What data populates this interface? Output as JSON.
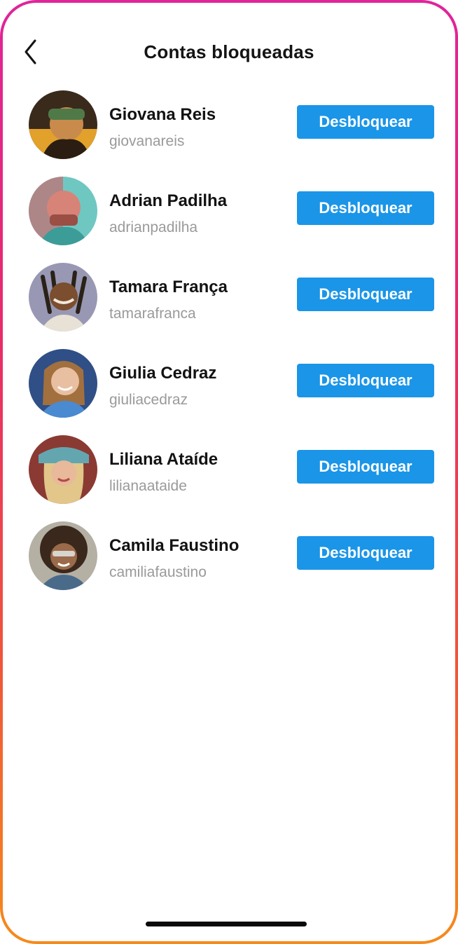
{
  "header": {
    "title": "Contas bloqueadas",
    "back_icon": "chevron-left-icon"
  },
  "colors": {
    "button": "#1a95e8",
    "frame_top": "#e0249a",
    "frame_bottom": "#f58a1c"
  },
  "blocked_accounts": [
    {
      "name": "Giovana Reis",
      "username": "giovanareis",
      "button_label": "Desbloquear"
    },
    {
      "name": "Adrian Padilha",
      "username": "adrianpadilha",
      "button_label": "Desbloquear"
    },
    {
      "name": "Tamara França",
      "username": "tamarafranca",
      "button_label": "Desbloquear"
    },
    {
      "name": "Giulia Cedraz",
      "username": "giuliacedraz",
      "button_label": "Desbloquear"
    },
    {
      "name": "Liliana Ataíde",
      "username": "lilianaataide",
      "button_label": "Desbloquear"
    },
    {
      "name": "Camila Faustino",
      "username": "camiliafaustino",
      "button_label": "Desbloquear"
    }
  ]
}
